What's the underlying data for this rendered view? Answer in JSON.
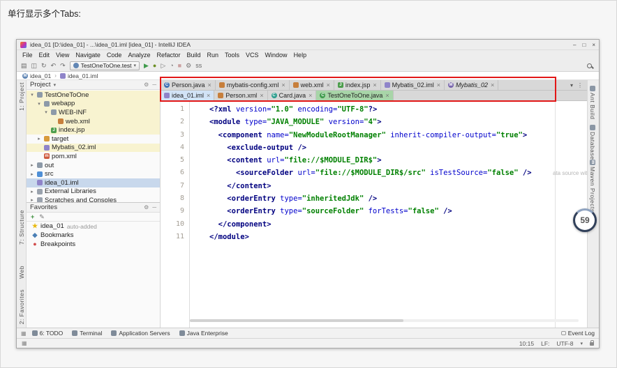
{
  "caption": "单行显示多个Tabs:",
  "colors": {
    "annotation_red": "#e21717",
    "tab_active_bg": "#d2e3f6",
    "tab_test_green_bg": "#a8d5a8",
    "tree_selection_bg": "#c8d8ec",
    "tree_highlight_bg": "#f8f3d0",
    "syntax_tag": "#000080",
    "syntax_attr": "#0000cc",
    "syntax_value": "#008000",
    "run_green": "#3f9b4c"
  },
  "window": {
    "title": "idea_01 [D:\\idea_01] - ...\\idea_01.iml [idea_01] - IntelliJ IDEA",
    "controls": {
      "minimize": "–",
      "maximize": "□",
      "close": "×"
    },
    "menu": [
      "File",
      "Edit",
      "View",
      "Navigate",
      "Code",
      "Analyze",
      "Refactor",
      "Build",
      "Run",
      "Tools",
      "VCS",
      "Window",
      "Help"
    ],
    "toolbar": {
      "left_icons": [
        {
          "name": "open-icon",
          "glyph": "▤"
        },
        {
          "name": "save-all-icon",
          "glyph": "◫"
        },
        {
          "name": "sync-icon",
          "glyph": "↻"
        },
        {
          "name": "undo-icon",
          "glyph": "↶"
        },
        {
          "name": "redo-icon",
          "glyph": "↷"
        }
      ],
      "run_config": "TestOneToOne.test",
      "right_icons": [
        {
          "name": "run-icon",
          "glyph": "▶",
          "color": "#3f9b4c"
        },
        {
          "name": "debug-icon",
          "glyph": "●",
          "color": "#6b8e23"
        },
        {
          "name": "run-coverage-icon",
          "glyph": "▷",
          "color": "#777777"
        },
        {
          "name": "profiler-icon",
          "glyph": "◔",
          "color": "#777777"
        },
        {
          "name": "stop-icon",
          "glyph": "■",
          "color": "#caa0a0"
        },
        {
          "name": "settings-icon",
          "glyph": "⚙",
          "color": "#777777"
        },
        {
          "name": "ss-icon",
          "glyph": "ss",
          "color": "#666666"
        }
      ]
    },
    "breadcrumb": [
      {
        "icon": "module",
        "color": "#6287b5",
        "label": "idea_01"
      },
      {
        "icon": "iml",
        "color": "#8f84c9",
        "label": "idea_01.iml"
      }
    ]
  },
  "left_strip": [
    {
      "label": "1: Project"
    },
    {
      "label": "7: Structure"
    },
    {
      "label": "Web"
    },
    {
      "label": "2: Favorites"
    }
  ],
  "project": {
    "header": {
      "title": "Project",
      "chevron": "▾"
    },
    "tree": [
      {
        "indent": 0,
        "arrow": "▾",
        "icon": "folder",
        "color": "#8d9aa8",
        "label": "TestOneToOne",
        "hl": "cream"
      },
      {
        "indent": 1,
        "arrow": "▾",
        "icon": "folder",
        "color": "#8d9aa8",
        "label": "webapp",
        "hl": "cream"
      },
      {
        "indent": 2,
        "arrow": "▾",
        "icon": "folder",
        "color": "#8d9aa8",
        "label": "WEB-INF",
        "hl": "cream"
      },
      {
        "indent": 3,
        "arrow": "",
        "icon": "xml",
        "color": "#c77f3c",
        "label": "web.xml",
        "hl": "cream"
      },
      {
        "indent": 2,
        "arrow": "",
        "icon": "jsp",
        "color": "#4d9e4d",
        "label": "index.jsp",
        "hl": "cream"
      },
      {
        "indent": 1,
        "arrow": "▸",
        "icon": "folder",
        "color": "#d89b3c",
        "label": "target",
        "hl": ""
      },
      {
        "indent": 1,
        "arrow": "",
        "icon": "iml",
        "color": "#8f84c9",
        "label": "Mybatis_02.iml",
        "hl": "cream"
      },
      {
        "indent": 1,
        "arrow": "",
        "icon": "mvn",
        "color": "#cf5b3f",
        "label": "pom.xml",
        "hl": ""
      },
      {
        "indent": 0,
        "arrow": "▸",
        "icon": "folder",
        "color": "#8d9aa8",
        "label": "out",
        "hl": ""
      },
      {
        "indent": 0,
        "arrow": "▸",
        "icon": "folder",
        "color": "#4f8fd6",
        "label": "src",
        "hl": ""
      },
      {
        "indent": 0,
        "arrow": "",
        "icon": "iml",
        "color": "#8f84c9",
        "label": "idea_01.iml",
        "hl": "sel"
      },
      {
        "indent": 0,
        "arrow": "▸",
        "icon": "lib",
        "color": "#9aa2ad",
        "label": "External Libraries",
        "hl": ""
      },
      {
        "indent": 0,
        "arrow": "▸",
        "icon": "scratch",
        "color": "#9aa2ad",
        "label": "Scratches and Consoles",
        "hl": ""
      }
    ],
    "favorites": {
      "title": "Favorites",
      "items": [
        {
          "icon": "star",
          "label": "idea_01",
          "suffix": "auto-added"
        },
        {
          "icon": "bookmark",
          "label": "Bookmarks",
          "suffix": ""
        },
        {
          "icon": "breakpoint",
          "label": "Breakpoints",
          "suffix": ""
        }
      ]
    }
  },
  "editor": {
    "tabs_row1": [
      {
        "icon": "class",
        "color": "#3f72b5",
        "label": "Person.java"
      },
      {
        "icon": "xml",
        "color": "#c77f3c",
        "label": "mybatis-config.xml"
      },
      {
        "icon": "xml",
        "color": "#c77f3c",
        "label": "web.xml"
      },
      {
        "icon": "jsp",
        "color": "#4d9e4d",
        "label": "index.jsp"
      },
      {
        "icon": "iml",
        "color": "#8f84c9",
        "label": "Mybatis_02.iml"
      },
      {
        "icon": "module",
        "color": "#7a68ae",
        "label": "Mybatis_02",
        "italic": true
      }
    ],
    "tabs_row2": [
      {
        "icon": "iml",
        "color": "#8f84c9",
        "label": "idea_01.iml",
        "state": "active"
      },
      {
        "icon": "xml",
        "color": "#c77f3c",
        "label": "Person.xml"
      },
      {
        "icon": "class",
        "color": "#2f9e8f",
        "label": "Card.java"
      },
      {
        "icon": "class",
        "color": "#3f9b4c",
        "label": "TestOneToOne.java",
        "state": "test"
      }
    ],
    "tab_bar_icons": [
      {
        "name": "show-hidden-tabs-icon",
        "glyph": "▾"
      },
      {
        "name": "editor-options-icon",
        "glyph": "⋮"
      }
    ],
    "lines": [
      [
        [
          "t",
          "<?xml "
        ],
        [
          "a",
          "version="
        ],
        [
          "s",
          "\"1.0\""
        ],
        [
          "p",
          " "
        ],
        [
          "a",
          "encoding="
        ],
        [
          "s",
          "\"UTF-8\""
        ],
        [
          "t",
          "?>"
        ]
      ],
      [
        [
          "t",
          "<module "
        ],
        [
          "a",
          "type="
        ],
        [
          "s",
          "\"JAVA_MODULE\""
        ],
        [
          "p",
          " "
        ],
        [
          "a",
          "version="
        ],
        [
          "s",
          "\"4\""
        ],
        [
          "t",
          ">"
        ]
      ],
      [
        [
          "p",
          "  "
        ],
        [
          "t",
          "<component "
        ],
        [
          "a",
          "name="
        ],
        [
          "s",
          "\"NewModuleRootManager\""
        ],
        [
          "p",
          " "
        ],
        [
          "a",
          "inherit-compiler-output="
        ],
        [
          "s",
          "\"true\""
        ],
        [
          "t",
          ">"
        ]
      ],
      [
        [
          "p",
          "    "
        ],
        [
          "t",
          "<exclude-output />"
        ]
      ],
      [
        [
          "p",
          "    "
        ],
        [
          "t",
          "<content "
        ],
        [
          "a",
          "url="
        ],
        [
          "s",
          "\"file://$MODULE_DIR$\""
        ],
        [
          "t",
          ">"
        ]
      ],
      [
        [
          "p",
          "      "
        ],
        [
          "t",
          "<sourceFolder "
        ],
        [
          "a",
          "url="
        ],
        [
          "s",
          "\"file://$MODULE_DIR$/src\""
        ],
        [
          "p",
          " "
        ],
        [
          "a",
          "isTestSource="
        ],
        [
          "s",
          "\"false\""
        ],
        [
          "p",
          " "
        ],
        [
          "t",
          "/>"
        ]
      ],
      [
        [
          "p",
          "    "
        ],
        [
          "t",
          "</content>"
        ]
      ],
      [
        [
          "p",
          "    "
        ],
        [
          "t",
          "<orderEntry "
        ],
        [
          "a",
          "type="
        ],
        [
          "s",
          "\"inheritedJdk\""
        ],
        [
          "p",
          " "
        ],
        [
          "t",
          "/>"
        ]
      ],
      [
        [
          "p",
          "    "
        ],
        [
          "t",
          "<orderEntry "
        ],
        [
          "a",
          "type="
        ],
        [
          "s",
          "\"sourceFolder\""
        ],
        [
          "p",
          " "
        ],
        [
          "a",
          "forTests="
        ],
        [
          "s",
          "\"false\""
        ],
        [
          "p",
          " "
        ],
        [
          "t",
          "/>"
        ]
      ],
      [
        [
          "p",
          "  "
        ],
        [
          "t",
          "</component>"
        ]
      ],
      [
        [
          "t",
          "</module>"
        ]
      ]
    ],
    "notice": "ata source with"
  },
  "right_strip": [
    {
      "icon": "ant",
      "label": "Ant Build"
    },
    {
      "icon": "db",
      "label": "Database"
    },
    {
      "icon": "mvn",
      "label": "Maven Projects"
    }
  ],
  "bottom_bar": {
    "tools": [
      {
        "icon": "todo",
        "label": "6: TODO"
      },
      {
        "icon": "terminal",
        "label": "Terminal"
      },
      {
        "icon": "server",
        "label": "Application Servers"
      },
      {
        "icon": "jee",
        "label": "Java Enterprise"
      }
    ],
    "event_log": "Event Log"
  },
  "status": {
    "caret": "10:15",
    "line_sep": "LF:",
    "encoding": "UTF-8"
  },
  "progress_badge": {
    "value": "59"
  }
}
